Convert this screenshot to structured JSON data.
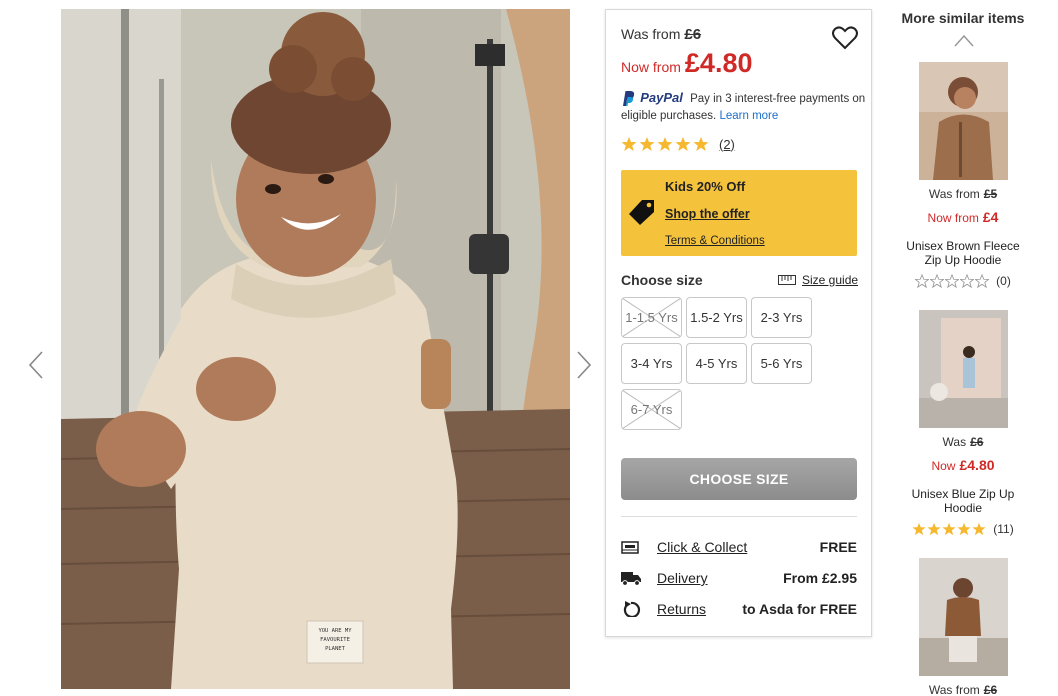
{
  "gallery": {
    "image_alt": "",
    "label_lines": [
      "YOU ARE MY",
      "FAVOURITE",
      "PLANET"
    ]
  },
  "product": {
    "was_label": "Was from",
    "was_price": "£6",
    "now_label": "Now from",
    "now_price": "£4.80",
    "paypal_brand": "PayPal",
    "paypal_text": "Pay in 3 interest-free payments on eligible purchases.",
    "paypal_link": "Learn more",
    "rating": 5,
    "review_count": "(2)",
    "offer": {
      "title": "Kids 20% Off",
      "link": "Shop the offer",
      "terms": "Terms & Conditions",
      "color": "#f5c33b"
    },
    "size_heading": "Choose size",
    "size_guide": "Size guide",
    "sizes": [
      {
        "label": "1-1.5 Yrs",
        "available": false
      },
      {
        "label": "1.5-2 Yrs",
        "available": true
      },
      {
        "label": "2-3 Yrs",
        "available": true
      },
      {
        "label": "3-4 Yrs",
        "available": true
      },
      {
        "label": "4-5 Yrs",
        "available": true
      },
      {
        "label": "5-6 Yrs",
        "available": true
      },
      {
        "label": "6-7 Yrs",
        "available": false
      }
    ],
    "cta": "CHOOSE SIZE",
    "delivery": [
      {
        "icon": "click-collect-icon",
        "label": "Click & Collect",
        "value": "FREE"
      },
      {
        "icon": "truck-icon",
        "label": "Delivery",
        "value": "From £2.95"
      },
      {
        "icon": "returns-icon",
        "label": "Returns",
        "value": "to Asda for FREE"
      }
    ],
    "price_color": "#d02a27",
    "star_color": "#f5b82e"
  },
  "similar": {
    "heading": "More similar items",
    "items": [
      {
        "was_label": "Was from",
        "was_price": "£5",
        "now_label": "Now from",
        "now_price": "£4",
        "name": "Unisex Brown Fleece Zip Up Hoodie",
        "rating": 0,
        "count": "(0)"
      },
      {
        "was_label": "Was",
        "was_price": "£6",
        "now_label": "Now",
        "now_price": "£4.80",
        "name": "Unisex Blue Zip Up Hoodie",
        "rating": 5,
        "count": "(11)"
      },
      {
        "was_label": "Was from",
        "was_price": "£6"
      }
    ]
  }
}
